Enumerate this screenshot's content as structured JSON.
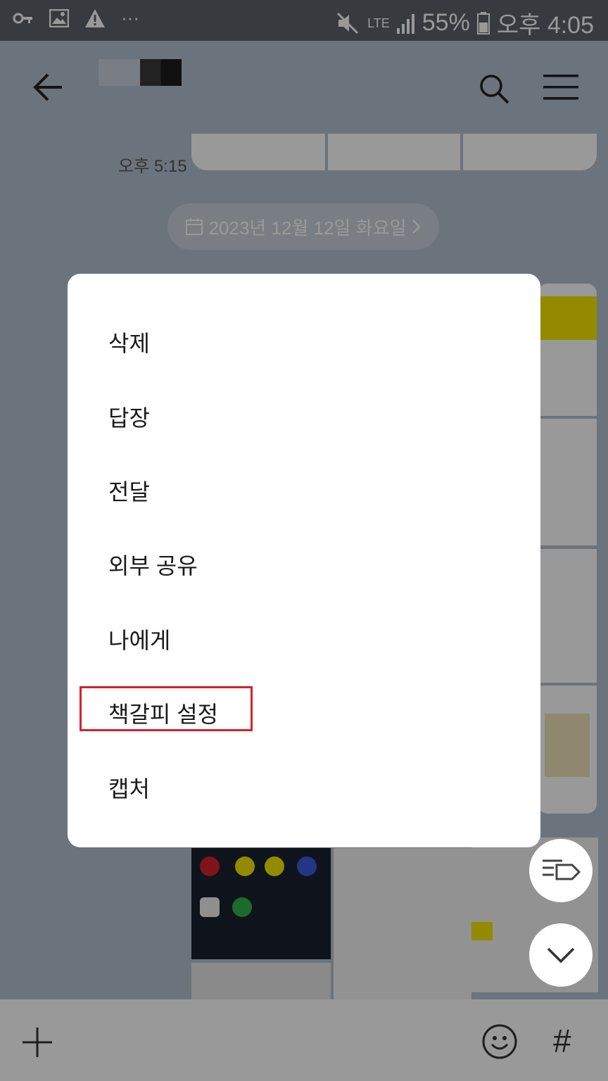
{
  "status": {
    "battery": "55%",
    "time": "오후 4:05",
    "network": "LTE",
    "more": "···"
  },
  "chat": {
    "time_label": "오후 5:15",
    "date_chip": "2023년 12월 12일 화요일"
  },
  "menu": {
    "items": [
      "삭제",
      "답장",
      "전달",
      "외부 공유",
      "나에게",
      "책갈피 설정",
      "캡처"
    ]
  },
  "bottombar": {
    "hash": "#"
  },
  "colors": {
    "highlight": "#d4232a",
    "menu_bg": "#ffffff",
    "kakao_yellow": "#f7e600"
  },
  "icons": [
    "key-icon",
    "image-icon",
    "warning-icon",
    "mute-icon",
    "signal-icon",
    "battery-icon",
    "back-arrow-icon",
    "search-icon",
    "menu-icon",
    "plus-icon",
    "emoji-icon",
    "tag-icon",
    "chevron-down-icon",
    "calendar-icon",
    "chevron-right-icon"
  ]
}
